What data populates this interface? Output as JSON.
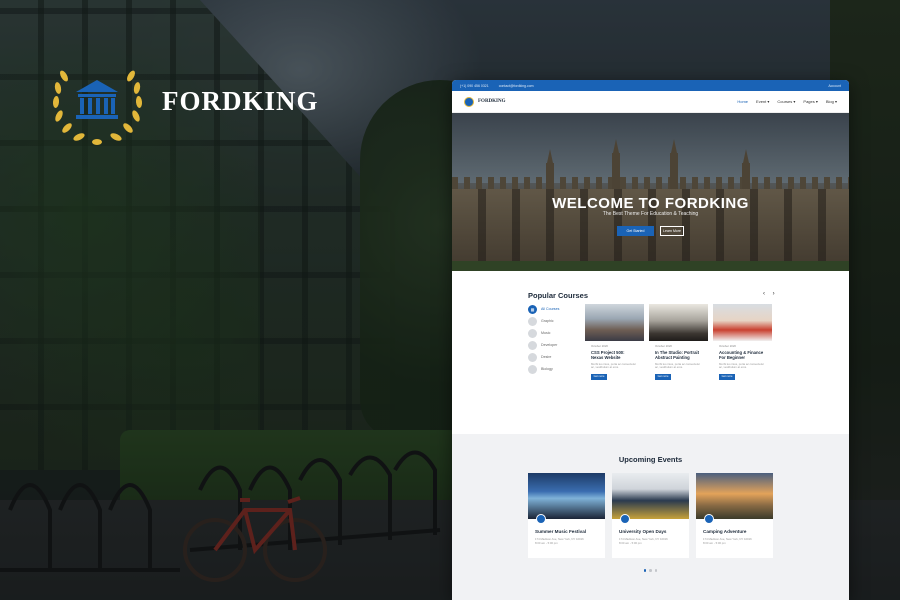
{
  "brand": {
    "name": "FORDKING",
    "colors": {
      "primary": "#1a63b6",
      "gold": "#e2b73a",
      "dark": "#1d2a3a"
    }
  },
  "site": {
    "topbar": {
      "phone": "(+1) 090 456 0321",
      "email": "contact@fordking.com",
      "login": "Account"
    },
    "nav": {
      "logo_text": "FORDKING",
      "menu": [
        "Home",
        "Event ▾",
        "Courses ▾",
        "Pages ▾",
        "Blog ▾"
      ]
    },
    "hero": {
      "title": "WELCOME TO FORDKING",
      "subtitle": "The Best Theme For Education & Teaching",
      "primary_button": "Get Started",
      "secondary_button": "Learn More"
    },
    "courses": {
      "title": "Popular Courses",
      "arrows": "‹ ›",
      "categories": [
        "All Courses",
        "Graphic",
        "Music",
        "Developer",
        "Desire",
        "Biology"
      ],
      "cards": [
        {
          "meta": "October 2020",
          "title": "CSS Project 500: Nexas Website",
          "desc": "Morbi leo risus, porta ac consectetur ac, vestibulum at eros.",
          "button": "Get more"
        },
        {
          "meta": "October 2020",
          "title": "In The Studio: Portrait Abstract Painting",
          "desc": "Morbi leo risus, porta ac consectetur ac, vestibulum at eros.",
          "button": "Get more"
        },
        {
          "meta": "October 2020",
          "title": "Accounting & Finance For Beginner",
          "desc": "Morbi leo risus, porta ac consectetur ac, vestibulum at eros.",
          "button": "Get more"
        }
      ]
    },
    "events": {
      "title": "Upcoming Events",
      "cards": [
        {
          "title": "Summer Music Festival",
          "location": "174 Madison Ave, New York, NY 10016",
          "time": "8:00 am - 5:00 pm"
        },
        {
          "title": "University Open Days",
          "location": "174 Madison Ave, New York, NY 10016",
          "time": "8:00 am - 5:00 pm"
        },
        {
          "title": "Camping Adventure",
          "location": "174 Madison Ave, New York, NY 10016",
          "time": "8:00 am - 5:00 pm"
        }
      ]
    }
  }
}
